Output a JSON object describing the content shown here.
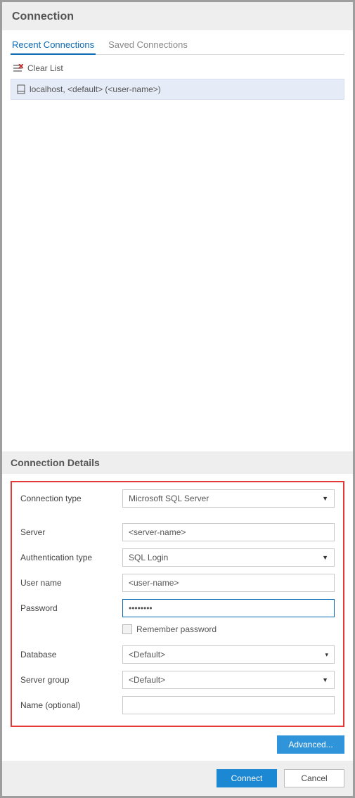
{
  "header": {
    "title": "Connection"
  },
  "tabs": {
    "recent": "Recent Connections",
    "saved": "Saved Connections"
  },
  "clearList": "Clear List",
  "connections": [
    {
      "label": "localhost, <default> (<user-name>)"
    }
  ],
  "detailsHeader": "Connection Details",
  "form": {
    "connectionType": {
      "label": "Connection type",
      "value": "Microsoft SQL Server"
    },
    "server": {
      "label": "Server",
      "value": "<server-name>"
    },
    "authType": {
      "label": "Authentication type",
      "value": "SQL Login"
    },
    "username": {
      "label": "User name",
      "value": "<user-name>"
    },
    "password": {
      "label": "Password",
      "value": "••••••••"
    },
    "remember": {
      "label": "Remember password"
    },
    "database": {
      "label": "Database",
      "value": "<Default>"
    },
    "serverGroup": {
      "label": "Server group",
      "value": "<Default>"
    },
    "name": {
      "label": "Name (optional)",
      "value": ""
    }
  },
  "buttons": {
    "advanced": "Advanced...",
    "connect": "Connect",
    "cancel": "Cancel"
  }
}
